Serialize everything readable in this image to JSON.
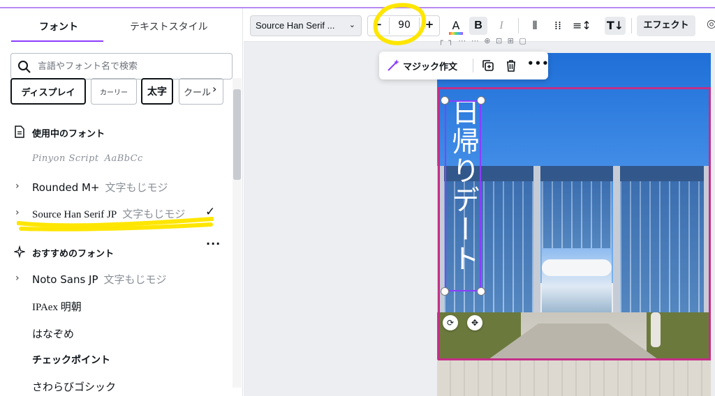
{
  "panel": {
    "tabs": [
      {
        "label": "フォント"
      },
      {
        "label": "テキストスタイル"
      }
    ],
    "search": {
      "placeholder": "言語やフォント名で検索"
    },
    "chips": [
      {
        "label": "ディスプレイ"
      },
      {
        "label": "カーリー"
      },
      {
        "label": "太字"
      },
      {
        "label": "クール"
      }
    ],
    "sections": {
      "in_use": {
        "title": "使用中のフォント"
      },
      "recommended": {
        "title": "おすすめのフォント"
      }
    },
    "in_use_fonts": [
      {
        "name": "Pinyon Script",
        "sample": "AaBbCc"
      },
      {
        "name": "Rounded M+",
        "sample": "文字もじモジ"
      },
      {
        "name": "Source Han Serif JP",
        "sample": "文字もじモジ"
      }
    ],
    "recommended_fonts": [
      {
        "name": "Noto Sans JP",
        "sample": "文字もじモジ"
      },
      {
        "name": "IPAex 明朝",
        "sample": ""
      },
      {
        "name": "はなぞめ",
        "sample": ""
      },
      {
        "name": "チェックポイント",
        "sample": ""
      },
      {
        "name": "さわらびゴシック",
        "sample": ""
      }
    ]
  },
  "toolbar": {
    "font_name": "Source Han Serif ...",
    "font_size": "90",
    "minus": "−",
    "plus": "+",
    "color_letter": "A",
    "bold": "B",
    "italic": "I",
    "effect_label": "エフェクト"
  },
  "float_menu": {
    "magic_label": "マジック作文"
  },
  "canvas": {
    "vertical_text": "日帰りデート"
  },
  "colors": {
    "accent": "#8b3dff",
    "selection": "#c52e87",
    "highlight": "#ffe600"
  },
  "icons": [
    "search-icon",
    "document-icon",
    "sparkle-icon",
    "chevron-right-icon",
    "check-icon",
    "magic-wand-icon",
    "duplicate-icon",
    "trash-icon",
    "more-icon",
    "rotate-icon",
    "move-icon"
  ]
}
